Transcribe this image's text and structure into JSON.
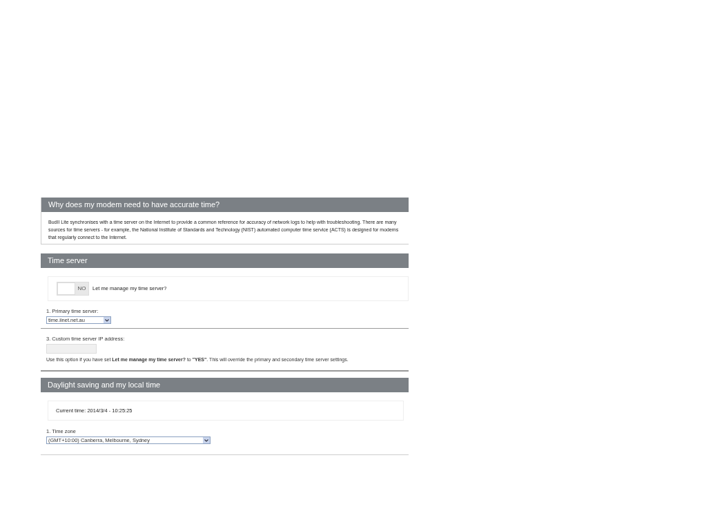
{
  "sections": [
    {
      "title": "Why does my modem need to have accurate time?",
      "paragraph": "BudII Lite synchronises with a time server on the Internet to provide a common reference for accuracy of network logs to help with troubleshooting. There are many sources for time servers - for example, the National Institute of Standards and Technology (NIST) automated computer time service (ACTS) is designed for modems that regularly connect to the Internet."
    },
    {
      "title": "Time server",
      "toggle": {
        "on": false,
        "state_text": "NO",
        "label": "Let me manage my time server?"
      },
      "primary_label": "1.  Primary time server:",
      "primary_value": "time.iinet.net.au",
      "custom_label": "3.  Custom time server IP address:",
      "note": "Use this option if you have set **Let me manage my time server?** to **\"YES\"**. This will override the primary and secondary time server settings."
    },
    {
      "title": "Daylight saving and my local time",
      "current_time": "Current time: 2014/3/4 - 10:25:25",
      "timezone_label": "1.  Time zone",
      "timezone_value": "(GMT+10:00) Canberra, Melbourne, Sydney"
    }
  ]
}
